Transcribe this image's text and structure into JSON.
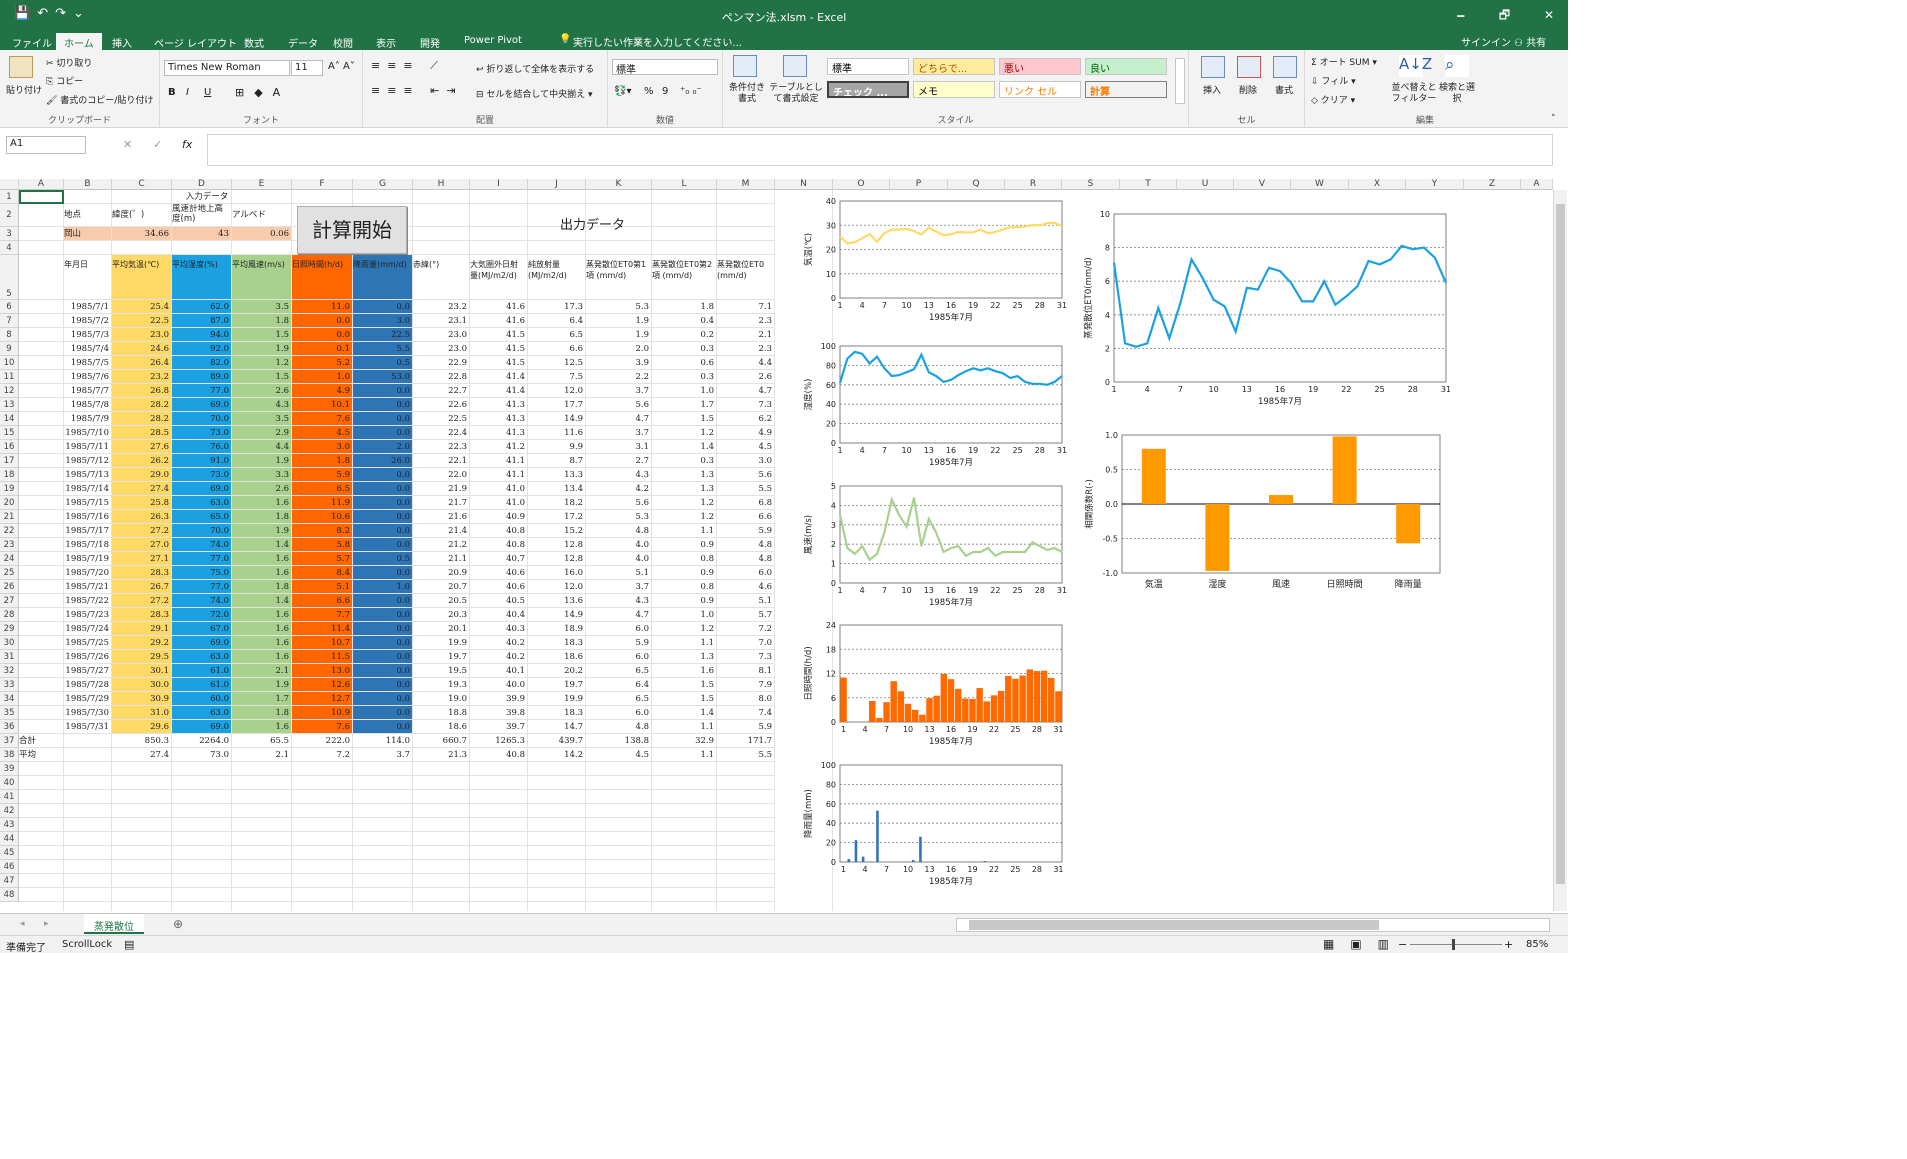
{
  "window": {
    "title": "ペンマン法.xlsm - Excel",
    "minimize": "🗕",
    "restore": "🗗",
    "close": "✕"
  },
  "qat": {
    "save": "💾",
    "undo": "↶",
    "redo": "↷",
    "customize": "⌄"
  },
  "ribbon_tabs": [
    "ファイル",
    "ホーム",
    "挿入",
    "ページ レイアウト",
    "数式",
    "データ",
    "校閲",
    "表示",
    "開発",
    "Power Pivot"
  ],
  "tell_me": "実行したい作業を入力してください...",
  "signin": "サインイン",
  "share": "共有",
  "ribbon": {
    "clipboard": {
      "paste": "貼り付け",
      "cut": "切り取り",
      "copy": "コピー",
      "format_painter": "書式のコピー/貼り付け",
      "label": "クリップボード"
    },
    "font": {
      "name": "Times New Roman",
      "size": "11",
      "bold": "B",
      "italic": "I",
      "underline": "U",
      "label": "フォント"
    },
    "alignment": {
      "wrap": "折り返して全体を表示する",
      "merge": "セルを結合して中央揃え",
      "label": "配置"
    },
    "number": {
      "format": "標準",
      "percent": "%",
      "comma": "9",
      "label": "数値"
    },
    "styles": {
      "cond": "条件付き書式",
      "table": "テーブルとして書式設定",
      "cells": [
        "標準",
        "どちらで...",
        "悪い",
        "良い",
        "チェック ...",
        "メモ",
        "リンク セル",
        "計算"
      ],
      "label": "スタイル"
    },
    "cells": {
      "insert": "挿入",
      "delete": "削除",
      "format": "書式",
      "label": "セル"
    },
    "editing": {
      "autosum": "オート SUM",
      "fill": "フィル",
      "clear": "クリア",
      "sort": "並べ替えとフィルター",
      "find": "検索と選択",
      "label": "編集"
    }
  },
  "formula_bar": {
    "name_box": "A1",
    "cancel": "✕",
    "enter": "✓",
    "fx": "fx",
    "value": ""
  },
  "columns": [
    "A",
    "B",
    "C",
    "D",
    "E",
    "F",
    "G",
    "H",
    "I",
    "J",
    "K",
    "L",
    "M",
    "N",
    "O",
    "P",
    "Q",
    "R",
    "S",
    "T",
    "U",
    "V",
    "W",
    "X",
    "Y",
    "Z",
    "A"
  ],
  "sheet": {
    "input_title": "入力データ",
    "output_title": "出力データ",
    "button": "計算開始",
    "labels": {
      "place": "地点",
      "lat": "緯度(゜)",
      "wind_h": "風速計地上高度(m)",
      "albedo": "アルベド"
    },
    "values": {
      "place": "岡山",
      "lat": "34.66",
      "wind_h": "43",
      "albedo": "0.06"
    },
    "headers": [
      "年月日",
      "平均気温(℃)",
      "平均湿度(%)",
      "平均風速(m/s)",
      "日照時間(h/d)",
      "降雨量(mm/d)",
      "赤緯(°)",
      "大気圏外日射量(MJ/m2/d)",
      "純放射量(MJ/m2/d)",
      "蒸発散位ET0第1項 (mm/d)",
      "蒸発散位ET0第2項 (mm/d)",
      "蒸発散位ET0 (mm/d)"
    ],
    "rows": [
      [
        "1985/7/1",
        "25.4",
        "62.0",
        "3.5",
        "11.0",
        "0.0",
        "23.2",
        "41.6",
        "17.3",
        "5.3",
        "1.8",
        "7.1"
      ],
      [
        "1985/7/2",
        "22.5",
        "87.0",
        "1.8",
        "0.0",
        "3.0",
        "23.1",
        "41.6",
        "6.4",
        "1.9",
        "0.4",
        "2.3"
      ],
      [
        "1985/7/3",
        "23.0",
        "94.0",
        "1.5",
        "0.0",
        "22.5",
        "23.0",
        "41.5",
        "6.5",
        "1.9",
        "0.2",
        "2.1"
      ],
      [
        "1985/7/4",
        "24.6",
        "92.0",
        "1.9",
        "0.1",
        "5.5",
        "23.0",
        "41.5",
        "6.6",
        "2.0",
        "0.3",
        "2.3"
      ],
      [
        "1985/7/5",
        "26.4",
        "82.0",
        "1.2",
        "5.2",
        "0.5",
        "22.9",
        "41.5",
        "12.5",
        "3.9",
        "0.6",
        "4.4"
      ],
      [
        "1985/7/6",
        "23.2",
        "89.0",
        "1.5",
        "1.0",
        "53.0",
        "22.8",
        "41.4",
        "7.5",
        "2.2",
        "0.3",
        "2.6"
      ],
      [
        "1985/7/7",
        "26.8",
        "77.0",
        "2.6",
        "4.9",
        "0.0",
        "22.7",
        "41.4",
        "12.0",
        "3.7",
        "1.0",
        "4.7"
      ],
      [
        "1985/7/8",
        "28.2",
        "69.0",
        "4.3",
        "10.1",
        "0.0",
        "22.6",
        "41.3",
        "17.7",
        "5.6",
        "1.7",
        "7.3"
      ],
      [
        "1985/7/9",
        "28.2",
        "70.0",
        "3.5",
        "7.6",
        "0.0",
        "22.5",
        "41.3",
        "14.9",
        "4.7",
        "1.5",
        "6.2"
      ],
      [
        "1985/7/10",
        "28.5",
        "73.0",
        "2.9",
        "4.5",
        "0.0",
        "22.4",
        "41.3",
        "11.6",
        "3.7",
        "1.2",
        "4.9"
      ],
      [
        "1985/7/11",
        "27.6",
        "76.0",
        "4.4",
        "3.0",
        "2.0",
        "22.3",
        "41.2",
        "9.9",
        "3.1",
        "1.4",
        "4.5"
      ],
      [
        "1985/7/12",
        "26.2",
        "91.0",
        "1.9",
        "1.8",
        "26.0",
        "22.1",
        "41.1",
        "8.7",
        "2.7",
        "0.3",
        "3.0"
      ],
      [
        "1985/7/13",
        "29.0",
        "73.0",
        "3.3",
        "5.9",
        "0.0",
        "22.0",
        "41.1",
        "13.3",
        "4.3",
        "1.3",
        "5.6"
      ],
      [
        "1985/7/14",
        "27.4",
        "69.0",
        "2.6",
        "6.5",
        "0.0",
        "21.9",
        "41.0",
        "13.4",
        "4.2",
        "1.3",
        "5.5"
      ],
      [
        "1985/7/15",
        "25.8",
        "63.0",
        "1.6",
        "11.9",
        "0.0",
        "21.7",
        "41.0",
        "18.2",
        "5.6",
        "1.2",
        "6.8"
      ],
      [
        "1985/7/16",
        "26.3",
        "65.0",
        "1.8",
        "10.6",
        "0.0",
        "21.6",
        "40.9",
        "17.2",
        "5.3",
        "1.2",
        "6.6"
      ],
      [
        "1985/7/17",
        "27.2",
        "70.0",
        "1.9",
        "8.2",
        "0.0",
        "21.4",
        "40.8",
        "15.2",
        "4.8",
        "1.1",
        "5.9"
      ],
      [
        "1985/7/18",
        "27.0",
        "74.0",
        "1.4",
        "5.8",
        "0.0",
        "21.2",
        "40.8",
        "12.8",
        "4.0",
        "0.9",
        "4.8"
      ],
      [
        "1985/7/19",
        "27.1",
        "77.0",
        "1.6",
        "5.7",
        "0.5",
        "21.1",
        "40.7",
        "12.8",
        "4.0",
        "0.8",
        "4.8"
      ],
      [
        "1985/7/20",
        "28.3",
        "75.0",
        "1.6",
        "8.4",
        "0.0",
        "20.9",
        "40.6",
        "16.0",
        "5.1",
        "0.9",
        "6.0"
      ],
      [
        "1985/7/21",
        "26.7",
        "77.0",
        "1.8",
        "5.1",
        "1.0",
        "20.7",
        "40.6",
        "12.0",
        "3.7",
        "0.8",
        "4.6"
      ],
      [
        "1985/7/22",
        "27.2",
        "74.0",
        "1.4",
        "6.6",
        "0.0",
        "20.5",
        "40.5",
        "13.6",
        "4.3",
        "0.9",
        "5.1"
      ],
      [
        "1985/7/23",
        "28.3",
        "72.0",
        "1.6",
        "7.7",
        "0.0",
        "20.3",
        "40.4",
        "14.9",
        "4.7",
        "1.0",
        "5.7"
      ],
      [
        "1985/7/24",
        "29.1",
        "67.0",
        "1.6",
        "11.4",
        "0.0",
        "20.1",
        "40.3",
        "18.9",
        "6.0",
        "1.2",
        "7.2"
      ],
      [
        "1985/7/25",
        "29.2",
        "69.0",
        "1.6",
        "10.7",
        "0.0",
        "19.9",
        "40.2",
        "18.3",
        "5.9",
        "1.1",
        "7.0"
      ],
      [
        "1985/7/26",
        "29.5",
        "63.0",
        "1.6",
        "11.5",
        "0.0",
        "19.7",
        "40.2",
        "18.6",
        "6.0",
        "1.3",
        "7.3"
      ],
      [
        "1985/7/27",
        "30.1",
        "61.0",
        "2.1",
        "13.0",
        "0.0",
        "19.5",
        "40.1",
        "20.2",
        "6.5",
        "1.6",
        "8.1"
      ],
      [
        "1985/7/28",
        "30.0",
        "61.0",
        "1.9",
        "12.6",
        "0.0",
        "19.3",
        "40.0",
        "19.7",
        "6.4",
        "1.5",
        "7.9"
      ],
      [
        "1985/7/29",
        "30.9",
        "60.0",
        "1.7",
        "12.7",
        "0.0",
        "19.0",
        "39.9",
        "19.9",
        "6.5",
        "1.5",
        "8.0"
      ],
      [
        "1985/7/30",
        "31.0",
        "63.0",
        "1.8",
        "10.9",
        "0.0",
        "18.8",
        "39.8",
        "18.3",
        "6.0",
        "1.4",
        "7.4"
      ],
      [
        "1985/7/31",
        "29.6",
        "69.0",
        "1.6",
        "7.6",
        "0.0",
        "18.6",
        "39.7",
        "14.7",
        "4.8",
        "1.1",
        "5.9"
      ]
    ],
    "total": [
      "合計",
      "",
      "850.3",
      "2264.0",
      "65.5",
      "222.0",
      "114.0",
      "660.7",
      "1265.3",
      "439.7",
      "138.8",
      "32.9",
      "171.7"
    ],
    "average": [
      "平均",
      "",
      "27.4",
      "73.0",
      "2.1",
      "7.2",
      "3.7",
      "21.3",
      "40.8",
      "14.2",
      "4.5",
      "1.1",
      "5.5"
    ]
  },
  "chart_data": [
    {
      "type": "line",
      "ylabel": "気温(℃)",
      "xlabel": "1985年7月",
      "ylim": [
        0,
        40
      ],
      "yticks": [
        0,
        10,
        20,
        30,
        40
      ],
      "color": "#ffd966",
      "series_ref": 1
    },
    {
      "type": "line",
      "ylabel": "湿度(%)",
      "xlabel": "1985年7月",
      "ylim": [
        0,
        100
      ],
      "yticks": [
        0,
        20,
        40,
        60,
        80,
        100
      ],
      "color": "#1ba1e2",
      "series_ref": 2
    },
    {
      "type": "line",
      "ylabel": "風速(m/s)",
      "xlabel": "1985年7月",
      "ylim": [
        0,
        5
      ],
      "yticks": [
        0,
        1,
        2,
        3,
        4,
        5
      ],
      "color": "#a9d18e",
      "series_ref": 3
    },
    {
      "type": "bar",
      "ylabel": "日照時間(h/d)",
      "xlabel": "1985年7月",
      "ylim": [
        0,
        24
      ],
      "yticks": [
        0,
        6,
        12,
        18,
        24
      ],
      "color": "#ff6a00",
      "series_ref": 4
    },
    {
      "type": "bar",
      "ylabel": "降雨量(mm)",
      "xlabel": "1985年7月",
      "ylim": [
        0,
        100
      ],
      "yticks": [
        0,
        20,
        40,
        60,
        80,
        100
      ],
      "color": "#2e75b6",
      "series_ref": 5
    },
    {
      "type": "line",
      "ylabel": "蒸発散位ET0(mm/d)",
      "xlabel": "1985年7月",
      "ylim": [
        0,
        10
      ],
      "yticks": [
        0,
        2,
        4,
        6,
        8,
        10
      ],
      "color": "#1ba1e2",
      "series_ref": 11
    },
    {
      "type": "bar",
      "ylabel": "相関係数R(-)",
      "categories": [
        "気温",
        "湿度",
        "風速",
        "日照時間",
        "降雨量"
      ],
      "values": [
        0.8,
        -0.97,
        0.13,
        0.98,
        -0.57
      ],
      "ylim": [
        -1,
        1
      ],
      "yticks": [
        -1.0,
        -0.5,
        0,
        0.5,
        1.0
      ],
      "color": "#ff9900"
    }
  ],
  "xticks": [
    1,
    4,
    7,
    10,
    13,
    16,
    19,
    22,
    25,
    28,
    31
  ],
  "sheet_tab": "蒸発散位",
  "status": {
    "ready": "準備完了",
    "scroll": "ScrollLock",
    "zoom": "85%"
  }
}
